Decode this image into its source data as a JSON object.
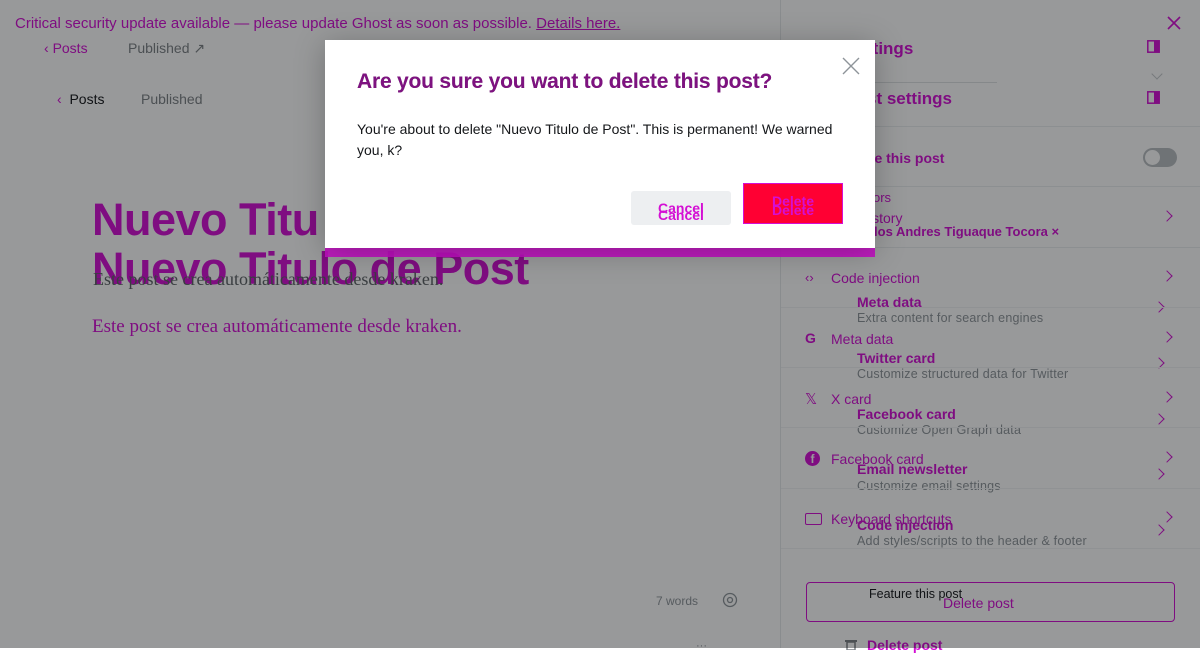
{
  "banner": {
    "message": "Critical security update available — please update Ghost as soon as possible.",
    "link": "Details here."
  },
  "editor": {
    "breadcrumb_back_top": "Posts",
    "status_top": "Published",
    "breadcrumb_back": "Posts",
    "status": "Published",
    "title": "Nuevo Titulo de Post",
    "title_partial": "Nuevo Titu",
    "subtitle_ghost": "Este post se crea automáticamente desde kraken.",
    "body": "Este post se crea automáticamente desde kraken.",
    "word_count": "7 words"
  },
  "sidebar": {
    "header_top": "Settings",
    "header_top_partial": "ttings",
    "header": "Post settings",
    "header_partial": "st settings",
    "feature_label": "Feature this post",
    "feature_partial": "re this post",
    "authors_label": "Authors",
    "authors_partial": "ors",
    "history_partial": "istory",
    "author_value": "Carlos Andres Tiguaque Tocora",
    "author_partial": "rlos Andres Tiguaque Tocora ×",
    "under_items": [
      "Code injection",
      "Meta data",
      "X card",
      "Facebook card",
      "Keyboard shortcuts"
    ],
    "items": [
      {
        "title": "Meta data",
        "sub": "Extra content for search engines"
      },
      {
        "title": "Twitter card",
        "sub": "Customize structured data for Twitter"
      },
      {
        "title": "Facebook card",
        "sub": "Customize Open Graph data"
      },
      {
        "title": "Email newsletter",
        "sub": "Customize email settings"
      },
      {
        "title": "Code injection",
        "sub": "Add styles/scripts to the header & footer"
      }
    ],
    "delete_button_ghost": "Delete post",
    "feature_button": "Feature this post",
    "delete_button": "Delete post"
  },
  "modal": {
    "title": "Are you sure you want to delete this post?",
    "body": "You're about to delete \"Nuevo Titulo de Post\". This is permanent! We warned you, k?",
    "cancel": "Cancel",
    "delete": "Delete"
  },
  "colors": {
    "accent": "#d40fd4",
    "danger": "#ff0033"
  }
}
